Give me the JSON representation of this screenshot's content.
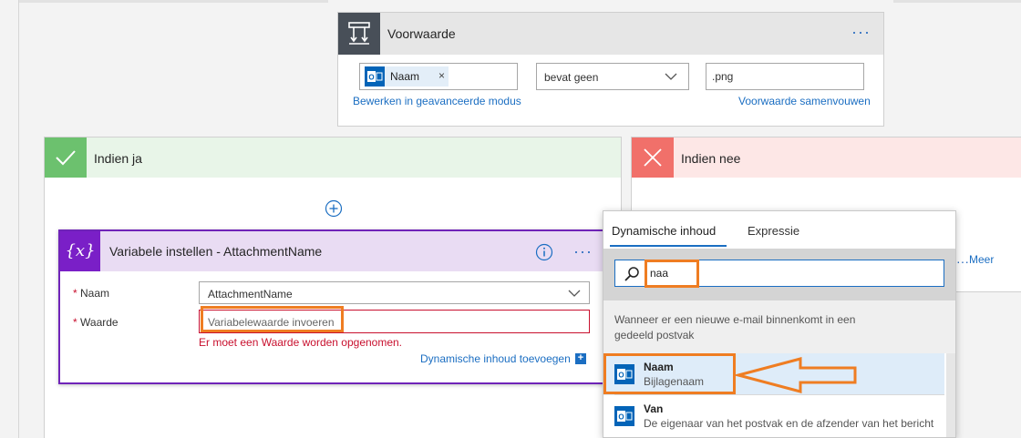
{
  "condition": {
    "title": "Voorwaarde",
    "menu": "···",
    "token_label": "Naam",
    "token_remove": "×",
    "operator": "bevat geen",
    "value": ".png",
    "advanced_link": "Bewerken in geavanceerde modus",
    "collapse_link": "Voorwaarde samenvouwen"
  },
  "yes_branch": {
    "title": "Indien ja"
  },
  "no_branch": {
    "title": "Indien nee",
    "more_dots": "···",
    "more": "Meer"
  },
  "set_variable": {
    "title": "Variabele instellen - AttachmentName",
    "menu": "···",
    "name_label": "Naam",
    "name_value": "AttachmentName",
    "value_label": "Waarde",
    "value_placeholder": "Variabelewaarde invoeren",
    "error": "Er moet een Waarde worden opgenomen.",
    "dynamic_link": "Dynamische inhoud toevoegen",
    "required_mark": "*",
    "icon_text": "{x}"
  },
  "popup": {
    "tabs": [
      {
        "label": "Dynamische inhoud"
      },
      {
        "label": "Expressie"
      }
    ],
    "search_value": "naa",
    "section": "Wanneer er een nieuwe e-mail binnenkomt in een gedeeld postvak",
    "items": [
      {
        "name": "Naam",
        "desc": "Bijlagenaam"
      },
      {
        "name": "Van",
        "desc": "De eigenaar van het postvak en de afzender van het bericht"
      }
    ]
  },
  "colors": {
    "accent": "#1b6ec2",
    "variable": "#7a1fc7",
    "yes": "#6cc16e",
    "no": "#f1706a",
    "error": "#c8102e",
    "highlight": "#ef7d22"
  }
}
